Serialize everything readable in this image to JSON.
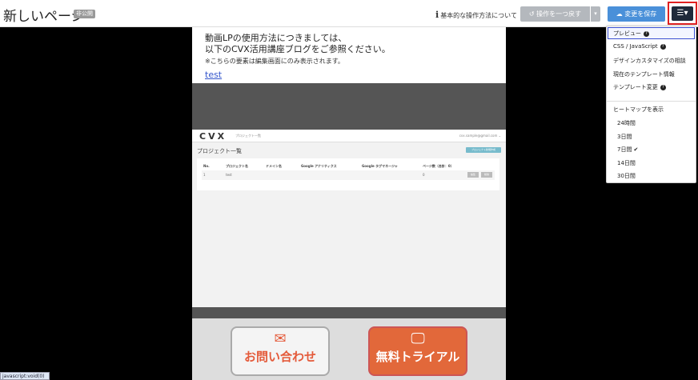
{
  "header": {
    "title": "新しいページ",
    "badge": "非公開",
    "help_link": "基本的な操作方法について",
    "undo_label": "操作を一つ戻す",
    "save_label": "変更を保存",
    "menu_icon": "hamburger-icon"
  },
  "notice": {
    "line1": "動画LPの使用方法につきましては、",
    "line2": "以下のCVX活用講座ブログをご参照ください。",
    "note": "※こちらの要素は編集画面にのみ表示されます。",
    "link": "test"
  },
  "video": {
    "logo": "CVX",
    "nav_item": "プロジェクト一覧",
    "user": "cvx.sample@gmail.com ⌄",
    "title": "プロジェクト一覧",
    "new_button": "プロジェクト新規作成",
    "columns": [
      "No.",
      "プロジェクト名",
      "ドメイン名",
      "Google アナリティクス",
      "Google タグマネージャ",
      "ページ数（合計：0）"
    ],
    "row": [
      "1",
      "test",
      "",
      "",
      "",
      "0"
    ],
    "row_buttons": [
      "編集",
      "削除"
    ]
  },
  "cta": {
    "contact_label": "お問い合わせ",
    "contact_icon": "envelope-icon",
    "trial_label": "無料トライアル",
    "trial_icon": "monitor-icon"
  },
  "dropdown": {
    "preview": "プレビュー",
    "css_js": "CSS / JavaScript",
    "design_consult": "デザインカスタマイズの相談",
    "template_info": "現在のテンプレート情報",
    "template_change": "テンプレート変更",
    "heatmap": "ヒートマップを表示",
    "h24": "24時間",
    "d3": "3日間",
    "d7": "7日間",
    "d14": "14日間",
    "d30": "30日間"
  },
  "status_bar": "javascript:void(0)",
  "colors": {
    "save": "#4a90d9",
    "menu": "#1f2a3a",
    "trial": "#e2683a",
    "highlight": "#e02020"
  }
}
